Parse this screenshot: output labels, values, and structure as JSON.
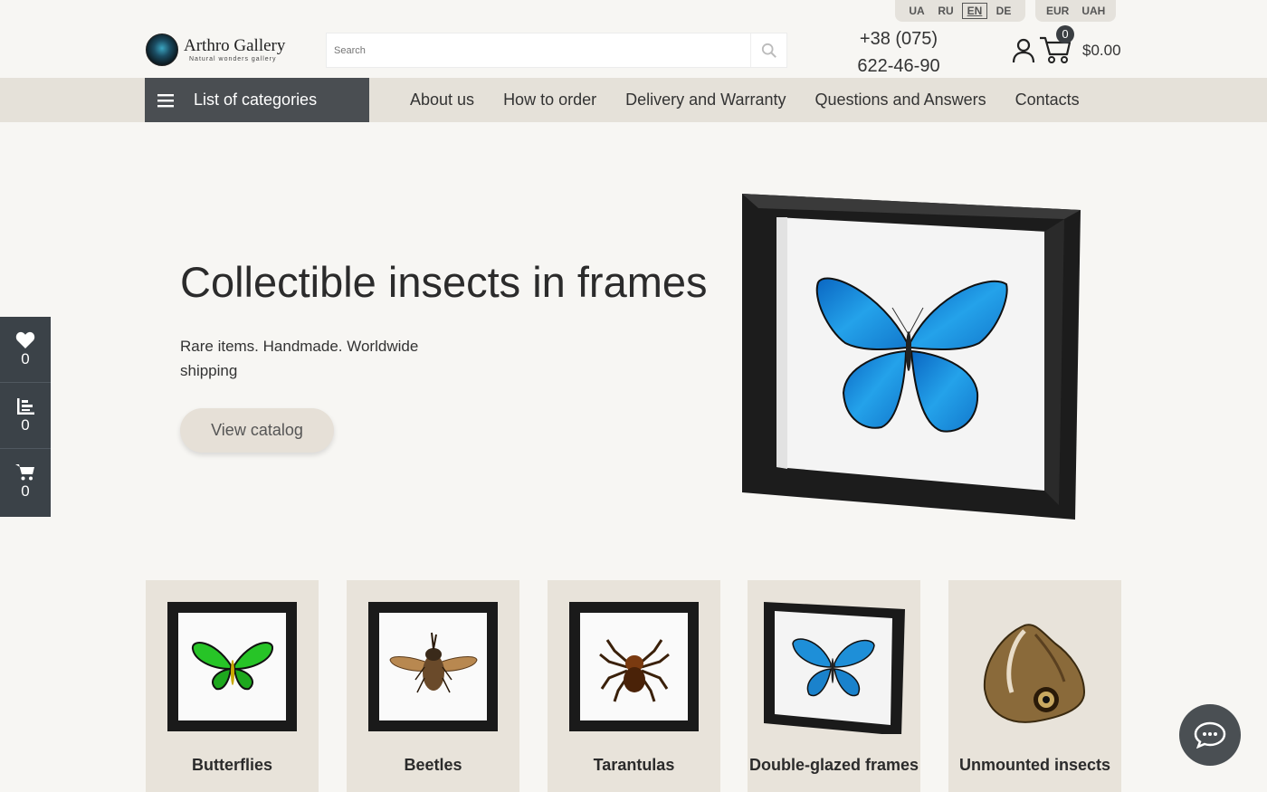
{
  "brand": {
    "name": "Arthro Gallery",
    "tagline": "Natural wonders gallery"
  },
  "search": {
    "placeholder": "Search"
  },
  "languages": [
    {
      "code": "UA",
      "active": false
    },
    {
      "code": "RU",
      "active": false
    },
    {
      "code": "EN",
      "active": true
    },
    {
      "code": "DE",
      "active": false
    }
  ],
  "currencies": [
    "EUR",
    "UAH"
  ],
  "contact": {
    "phone_line1": "+38 (075)",
    "phone_line2": "622-46-90"
  },
  "cart": {
    "count": "0",
    "total": "$0.00"
  },
  "nav": {
    "categories_label": "List of categories",
    "links": [
      "About us",
      "How to order",
      "Delivery and Warranty",
      "Questions and Answers",
      "Contacts"
    ]
  },
  "hero": {
    "title": "Collectible insects in frames",
    "subtitle": "Rare items. Handmade. Worldwide shipping",
    "button_label": "View catalog"
  },
  "side_toolbar": {
    "favorites_count": "0",
    "compare_count": "0",
    "cart_count": "0"
  },
  "categories": [
    {
      "label": "Butterflies",
      "icon": "green-butterfly-frame"
    },
    {
      "label": "Beetles",
      "icon": "beetle-frame"
    },
    {
      "label": "Tarantulas",
      "icon": "tarantula-frame"
    },
    {
      "label": "Double-glazed frames",
      "icon": "blue-butterfly-double-frame"
    },
    {
      "label": "Unmounted insects",
      "icon": "owl-butterfly"
    }
  ],
  "colors": {
    "background": "#f7f6f3",
    "nav_bar": "#e5e1d9",
    "dark_accent": "#4a4e52",
    "card_bg": "#e8e3da",
    "morpho_blue": "#1e8fd8"
  }
}
